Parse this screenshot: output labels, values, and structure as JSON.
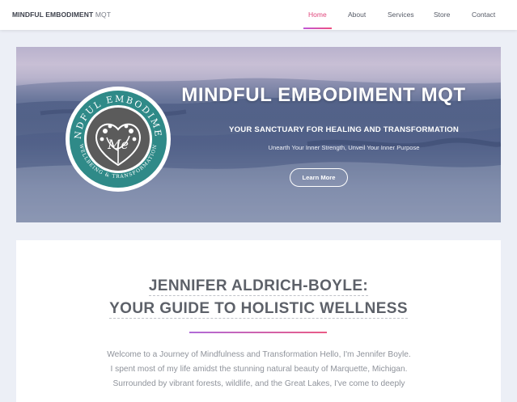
{
  "nav": {
    "brand_bold": "MINDFUL EMBODIMENT",
    "brand_thin": "MQT",
    "links": [
      {
        "label": "Home",
        "active": true
      },
      {
        "label": "About",
        "active": false
      },
      {
        "label": "Services",
        "active": false
      },
      {
        "label": "Store",
        "active": false
      },
      {
        "label": "Contact",
        "active": false
      }
    ]
  },
  "hero": {
    "title": "MINDFUL EMBODIMENT MQT",
    "subtitle": "YOUR SANCTUARY FOR HEALING AND TRANSFORMATION",
    "tagline": "Unearth Your Inner Strength, Unveil Your Inner Purpose",
    "button_label": "Learn More",
    "logo": {
      "ring_top_text": "MINDFUL EMBODIMENT",
      "ring_bottom_text": "WELLBEING & TRANSFORMATION",
      "monogram": "Me",
      "ring_color": "#2f8a88",
      "center_color": "#5b5b5b"
    }
  },
  "intro": {
    "heading_line1": "JENNIFER ALDRICH-BOYLE:",
    "heading_line2": "YOUR GUIDE TO HOLISTIC WELLNESS",
    "paragraph_lines": [
      "Welcome to a Journey of Mindfulness and Transformation Hello, I'm Jennifer Boyle.",
      "I spent most of my life amidst the stunning natural beauty of Marquette, Michigan.",
      "Surrounded by vibrant forests, wildlife, and the Great Lakes, I've come to deeply"
    ]
  },
  "colors": {
    "accent": "#e0467c",
    "accent_gradient_start": "#c058d8"
  }
}
